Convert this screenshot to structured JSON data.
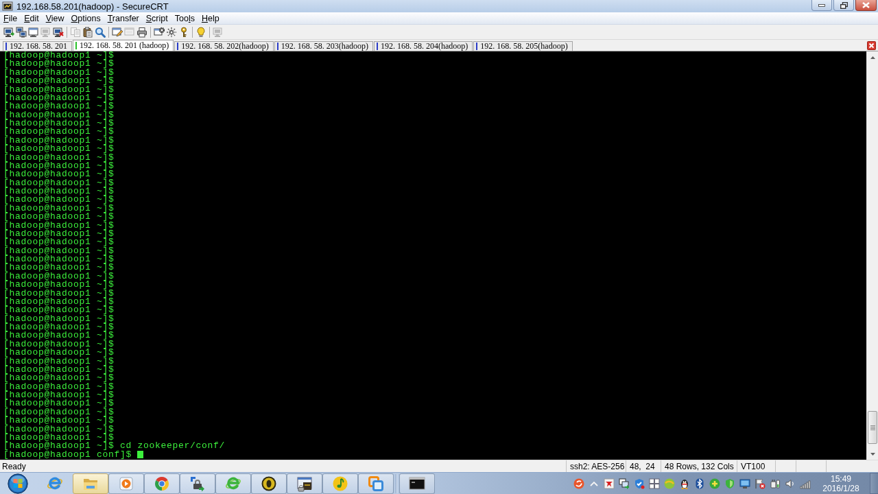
{
  "window": {
    "title": "192.168.58.201(hadoop) - SecureCRT"
  },
  "menu": [
    {
      "key": "F",
      "rest": "ile"
    },
    {
      "key": "E",
      "rest": "dit"
    },
    {
      "key": "V",
      "rest": "iew"
    },
    {
      "key": "O",
      "rest": "ptions"
    },
    {
      "key": "T",
      "rest": "ransfer"
    },
    {
      "key": "S",
      "rest": "cript"
    },
    {
      "lead": "Too",
      "key": "l",
      "rest": "s"
    },
    {
      "key": "H",
      "rest": "elp"
    }
  ],
  "toolbar": {
    "groups": [
      [
        {
          "disabled": false
        },
        {
          "disabled": false
        },
        {
          "disabled": false
        },
        {
          "disabled": true
        },
        {
          "disabled": false
        }
      ],
      [
        {
          "disabled": true
        },
        {
          "disabled": false
        },
        {
          "disabled": false
        }
      ],
      [
        {
          "disabled": false
        },
        {
          "disabled": true
        },
        {
          "disabled": false
        }
      ],
      [
        {
          "disabled": false
        },
        {
          "disabled": false
        },
        {
          "disabled": false
        }
      ],
      [
        {
          "disabled": false
        }
      ],
      [
        {
          "disabled": true
        }
      ]
    ]
  },
  "tabs": [
    {
      "label": "192. 168. 58. 201",
      "selected": false,
      "color": "#2a3cc8"
    },
    {
      "label": "192. 168. 58. 201 (hadoop)",
      "selected": true,
      "color": "#28c028"
    },
    {
      "label": "192. 168. 58. 202(hadoop)",
      "selected": false,
      "color": "#2a3cc8"
    },
    {
      "label": "192. 168. 58. 203(hadoop)",
      "selected": false,
      "color": "#2a3cc8"
    },
    {
      "label": "192. 168. 58. 204(hadoop)",
      "selected": false,
      "color": "#2a3cc8"
    },
    {
      "label": "192. 168. 58. 205(hadoop)",
      "selected": false,
      "color": "#2a3cc8"
    }
  ],
  "terminal": {
    "lines": [
      "[hadoop@hadoop1 ~]$",
      "[hadoop@hadoop1 ~]$",
      "[hadoop@hadoop1 ~]$",
      "[hadoop@hadoop1 ~]$",
      "[hadoop@hadoop1 ~]$",
      "[hadoop@hadoop1 ~]$",
      "[hadoop@hadoop1 ~]$",
      "[hadoop@hadoop1 ~]$",
      "[hadoop@hadoop1 ~]$",
      "[hadoop@hadoop1 ~]$",
      "[hadoop@hadoop1 ~]$",
      "[hadoop@hadoop1 ~]$",
      "[hadoop@hadoop1 ~]$",
      "[hadoop@hadoop1 ~]$",
      "[hadoop@hadoop1 ~]$",
      "[hadoop@hadoop1 ~]$",
      "[hadoop@hadoop1 ~]$",
      "[hadoop@hadoop1 ~]$",
      "[hadoop@hadoop1 ~]$",
      "[hadoop@hadoop1 ~]$",
      "[hadoop@hadoop1 ~]$",
      "[hadoop@hadoop1 ~]$",
      "[hadoop@hadoop1 ~]$",
      "[hadoop@hadoop1 ~]$",
      "[hadoop@hadoop1 ~]$",
      "[hadoop@hadoop1 ~]$",
      "[hadoop@hadoop1 ~]$",
      "[hadoop@hadoop1 ~]$",
      "[hadoop@hadoop1 ~]$",
      "[hadoop@hadoop1 ~]$",
      "[hadoop@hadoop1 ~]$",
      "[hadoop@hadoop1 ~]$",
      "[hadoop@hadoop1 ~]$",
      "[hadoop@hadoop1 ~]$",
      "[hadoop@hadoop1 ~]$",
      "[hadoop@hadoop1 ~]$",
      "[hadoop@hadoop1 ~]$",
      "[hadoop@hadoop1 ~]$",
      "[hadoop@hadoop1 ~]$",
      "[hadoop@hadoop1 ~]$",
      "[hadoop@hadoop1 ~]$",
      "[hadoop@hadoop1 ~]$",
      "[hadoop@hadoop1 ~]$",
      "[hadoop@hadoop1 ~]$",
      "[hadoop@hadoop1 ~]$",
      "[hadoop@hadoop1 ~]$",
      "[hadoop@hadoop1 ~]$ cd zookeeper/conf/",
      "[hadoop@hadoop1 conf]$"
    ],
    "cursor": true
  },
  "status_bar": {
    "message": "Ready",
    "sections": [
      "ssh2: AES-256",
      "48,  24",
      "48 Rows, 132 Cols",
      "VT100"
    ]
  },
  "taskbar": {
    "items": [
      {
        "running": false,
        "active": false
      },
      {
        "running": true,
        "active": true
      },
      {
        "running": true,
        "active": false
      },
      {
        "running": true,
        "active": false
      },
      {
        "running": true,
        "active": false
      },
      {
        "running": true,
        "active": false
      },
      {
        "running": true,
        "active": false
      },
      {
        "running": true,
        "active": false
      },
      {
        "running": true,
        "active": false
      },
      {
        "running": true,
        "active": false
      },
      {
        "running": true,
        "active": false
      }
    ],
    "clock": {
      "time": "15:49",
      "date": "2016/1/28"
    }
  }
}
